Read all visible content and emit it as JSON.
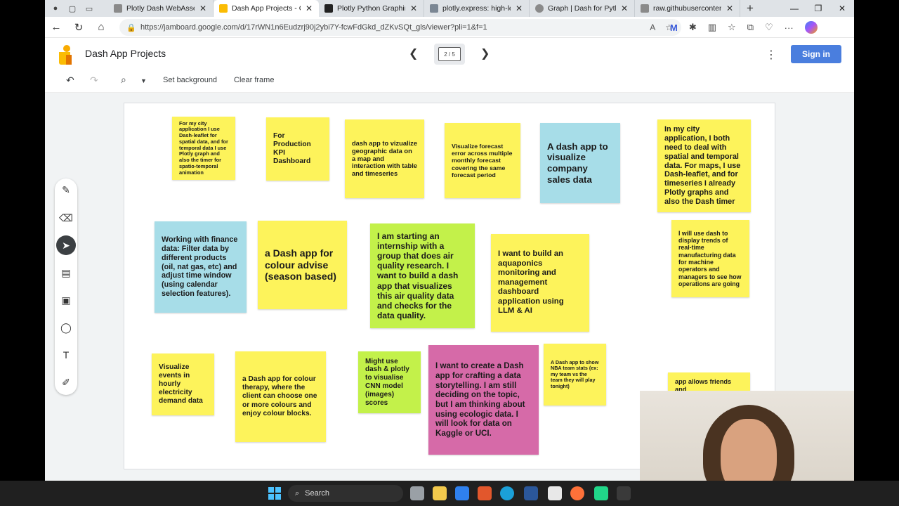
{
  "browser": {
    "tabs": [
      {
        "title": "Plotly Dash WebAssembly",
        "color": "#8a8a8a"
      },
      {
        "title": "Dash App Projects - Goo",
        "color": "#fbbc04"
      },
      {
        "title": "Plotly Python Graphing Li",
        "color": "#222222"
      },
      {
        "title": "plotly.express: high-level",
        "color": "#7b8794"
      },
      {
        "title": "Graph | Dash for Python",
        "color": "#8a8a8a"
      },
      {
        "title": "raw.githubusercontent.co",
        "color": "#8a8a8a"
      }
    ],
    "url": "https://jamboard.google.com/d/17rWN1n6Eudzrj90j2ybi7Y-fcwFdGkd_dZKvSQt_gls/viewer?pli=1&f=1"
  },
  "jamboard": {
    "title": "Dash App Projects",
    "frame_indicator": "2 / 5",
    "sign_in": "Sign in",
    "set_background": "Set background",
    "clear_frame": "Clear frame"
  },
  "notes": [
    {
      "text": "For my city application I use Dash-leaflet for spatial data, and for temporal data I use Plotly graph and also the timer for spatio-temporal animation",
      "color": "yellow"
    },
    {
      "text": "For Production KPI Dashboard",
      "color": "yellow"
    },
    {
      "text": "dash app to vizualize geographic data on a map and interaction with table and timeseries",
      "color": "yellow"
    },
    {
      "text": "Visualize forecast error across multiple monthly forecast covering the same forecast period",
      "color": "yellow"
    },
    {
      "text": "A dash app to visualize company sales data",
      "color": "blue"
    },
    {
      "text": "In my city application, I both need to deal with spatial and temporal data. For maps, I use Dash-leaflet, and for timeseries I already Plotly graphs and also the Dash timer",
      "color": "yellow"
    },
    {
      "text": "Working with finance data: Filter data by different products (oil, nat gas, etc) and adjust time window (using calendar selection features).",
      "color": "blue"
    },
    {
      "text": "a Dash app for colour advise (season based)",
      "color": "yellow"
    },
    {
      "text": "I am starting an internship with a group that does air quality research. I want to build a dash app that visualizes this air quality data and checks for the data quality.",
      "color": "green"
    },
    {
      "text": "I want to build an aquaponics monitoring  and management dashboard application using LLM & AI",
      "color": "yellow"
    },
    {
      "text": "I will use dash to display trends of real-time manufacturing data for machine operators and managers to see how operations are going",
      "color": "yellow"
    },
    {
      "text": "Visualize events in hourly electricity demand data",
      "color": "yellow"
    },
    {
      "text": "a Dash app for colour therapy, where the client can choose one or more colours and enjoy colour blocks.",
      "color": "yellow"
    },
    {
      "text": "Might use dash & plotly to visualise CNN model (images) scores",
      "color": "green"
    },
    {
      "text": "I want to create a Dash app for crafting a data storytelling. I am still deciding on the topic, but I am thinking about using ecologic data. I will look for data on Kaggle or UCI.",
      "color": "pink"
    },
    {
      "text": "A Dash app to show NBA team stats (ex: my team vs the team they will play tonight)",
      "color": "yellow"
    },
    {
      "text": "app allows friends and",
      "color": "yellow"
    }
  ],
  "taskbar": {
    "search_label": "Search"
  }
}
